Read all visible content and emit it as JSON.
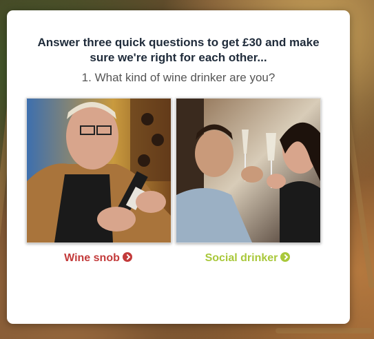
{
  "modal": {
    "heading": "Answer three quick questions to get £30 and make sure we're right for each other...",
    "question": "1. What kind of wine drinker are you?"
  },
  "choices": [
    {
      "label": "Wine snob",
      "color": "#c33b3b",
      "image": "man-holding-wine-bottle-photo",
      "icon": "chevron-right-circle-icon"
    },
    {
      "label": "Social drinker",
      "color": "#a9c83b",
      "image": "friends-toasting-wine-glasses-photo",
      "icon": "chevron-right-circle-icon"
    }
  ]
}
